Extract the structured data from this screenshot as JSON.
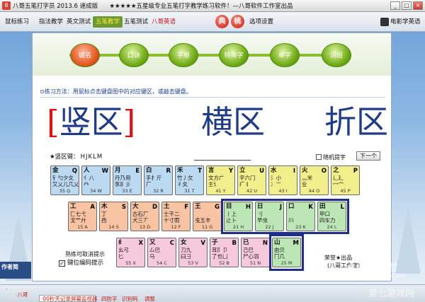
{
  "window": {
    "title": "八哥五笔打字员 2013.6 速成版",
    "subtitle": "★★★★★五星级专业五笔打字教学练习软件！—八哥软件工作室出品",
    "min": "_",
    "max": "□",
    "close": "×"
  },
  "menu": {
    "items": [
      "鼠标练习",
      "指法教学",
      "英文测试",
      "五笔教学",
      "五笔测试",
      "八哥英语"
    ],
    "active_index": 3,
    "special_index": 5,
    "circle1": "典",
    "circle2": "桃",
    "options": "选项设置",
    "movie": "电影学英语"
  },
  "modes": [
    "键名",
    "口诀",
    "字根",
    "特殊字",
    "单字",
    "词组"
  ],
  "active_mode": 0,
  "hint": "⊙练习方法：用鼠标点击键盘图中的对应键区，或敲击键盘。",
  "big": {
    "w1_l": "[",
    "w1": "竖区",
    "w1_r": "]",
    "w2": "横区",
    "w3": "折区"
  },
  "code": {
    "label": "★竖区键：",
    "value": "HJKLM"
  },
  "random_label": "随机提字",
  "next_label": "下一个",
  "rows": {
    "r1": [
      {
        "g": "金",
        "r": "钅勺夕夂",
        "r2": "又乂儿几乂",
        "code": "Q",
        "num": "35 Q"
      },
      {
        "g": "人",
        "r": "亻八",
        "r2": "癶",
        "code": "W",
        "num": "34 W"
      },
      {
        "g": "月",
        "r": "丹乃用",
        "r2": "豕⺼彡",
        "code": "E",
        "num": "33 E"
      },
      {
        "g": "白",
        "r": "手扌斤",
        "r2": "厂",
        "code": "R",
        "num": "32 R"
      },
      {
        "g": "禾",
        "r": "竹丿攵",
        "r2": "彳夂",
        "code": "T",
        "num": "31 T"
      },
      {
        "g": "言",
        "r": "文方广",
        "r2": "主讠",
        "code": "Y",
        "num": "41 Y"
      },
      {
        "g": "立",
        "r": "辛六门",
        "r2": "疒丬",
        "code": "U",
        "num": "42 U"
      },
      {
        "g": "水",
        "r": "氵小",
        "r2": "冫⺌",
        "code": "I",
        "num": "43 I"
      },
      {
        "g": "火",
        "r": "灬米",
        "r2": "业",
        "code": "O",
        "num": "44 O"
      },
      {
        "g": "之",
        "r": "辶廴",
        "r2": "冖宀",
        "code": "P",
        "num": "45 P"
      }
    ],
    "r2": [
      {
        "g": "工",
        "r": "匚七弋",
        "r2": "戈艹廾",
        "code": "A",
        "num": "15 A"
      },
      {
        "g": "木",
        "r": "丁",
        "r2": "西",
        "code": "S",
        "num": "14 S"
      },
      {
        "g": "大",
        "r": "古石厂",
        "r2": "犬三丆",
        "code": "D",
        "num": "13 D"
      },
      {
        "g": "土",
        "r": "士干二",
        "r2": "十寸雨",
        "code": "F",
        "num": "12 F"
      },
      {
        "g": "王",
        "r": "",
        "r2": "戋五丰",
        "code": "G",
        "num": "11 G"
      },
      {
        "g": "目",
        "r": "丨上",
        "r2": "止卜",
        "code": "H",
        "num": "21 H"
      },
      {
        "g": "日",
        "r": "刂",
        "r2": "早虫",
        "code": "J",
        "num": "22 J"
      },
      {
        "g": "口",
        "r": "",
        "r2": "川",
        "code": "K",
        "num": "23 K"
      },
      {
        "g": "田",
        "r": "甲口",
        "r2": "四车力",
        "code": "L",
        "num": "24 L"
      }
    ],
    "r3": [
      {
        "g": "纟",
        "r": "幺弓",
        "r2": "匕",
        "code": "X",
        "num": "55 X"
      },
      {
        "g": "又",
        "r": "厶巴",
        "r2": "马",
        "code": "C",
        "num": "54 C"
      },
      {
        "g": "女",
        "r": "刀九",
        "r2": "臼⺕",
        "code": "V",
        "num": "53 V"
      },
      {
        "g": "子",
        "r": "耳阝卩",
        "r2": "了也凵",
        "code": "B",
        "num": "52 B"
      },
      {
        "g": "已",
        "r": "己巳",
        "r2": "尸心羽",
        "code": "N",
        "num": "51 N"
      },
      {
        "g": "山",
        "r": "由贝",
        "r2": "冂几",
        "code": "M",
        "num": "25 M"
      }
    ]
  },
  "toggle_hint": "熟练可取消提示",
  "toggle_label": "键位编码提示",
  "toggle_check": "✓",
  "credit": "荣誉★出品",
  "credit2": "(八哥工作室)",
  "author": "作者简",
  "status": {
    "s1": "·",
    "s2": "·八哥",
    "s3": "·00秒天记录屏幕监视器",
    "s4": "四防字",
    "s5": "识别码",
    "s6": "调整"
  },
  "watermark": {
    "a": "Baidu经验",
    "b": "jingyan.baidu.com",
    "c": "第七游戏网"
  }
}
